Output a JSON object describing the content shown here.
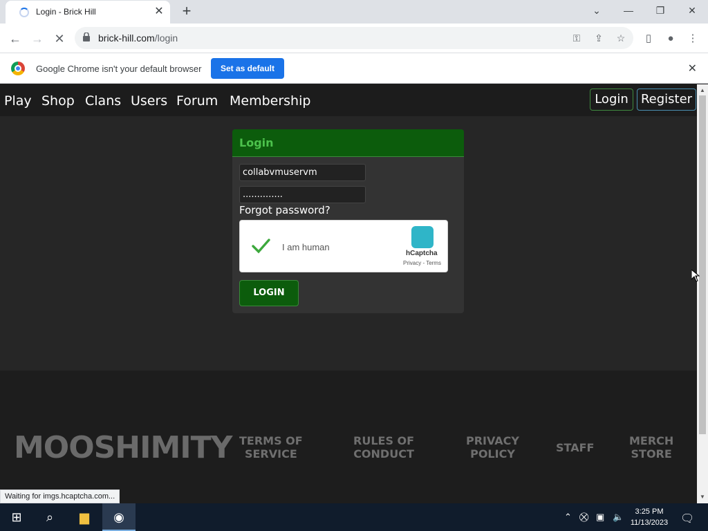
{
  "browser": {
    "tab_title": "Login - Brick Hill",
    "url_domain": "brick-hill.com",
    "url_path": "/login",
    "infobar_message": "Google Chrome isn't your default browser",
    "set_default_label": "Set as default",
    "status_text": "Waiting for imgs.hcaptcha.com..."
  },
  "nav": {
    "links": [
      "Play",
      "Shop",
      "Clans",
      "Users",
      "Forum",
      "Membership"
    ],
    "login": "Login",
    "register": "Register"
  },
  "login_form": {
    "header": "Login",
    "username_value": "collabvmuservm",
    "password_value": "..............",
    "forgot_password": "Forgot password?",
    "captcha_label": "I am human",
    "captcha_brand": "hCaptcha",
    "captcha_links": "Privacy - Terms",
    "submit_label": "LOGIN"
  },
  "footer": {
    "logo_text": "MOOSHIMITY",
    "links": [
      "TERMS OF\nSERVICE",
      "RULES OF\nCONDUCT",
      "PRIVACY\nPOLICY",
      "STAFF",
      "MERCH\nSTORE"
    ]
  },
  "taskbar": {
    "time": "3:25 PM",
    "date": "11/13/2023"
  },
  "colors": {
    "accent_green": "#0c5c0c",
    "header_green_text": "#4cc24c",
    "chrome_blue": "#1a73e8"
  }
}
